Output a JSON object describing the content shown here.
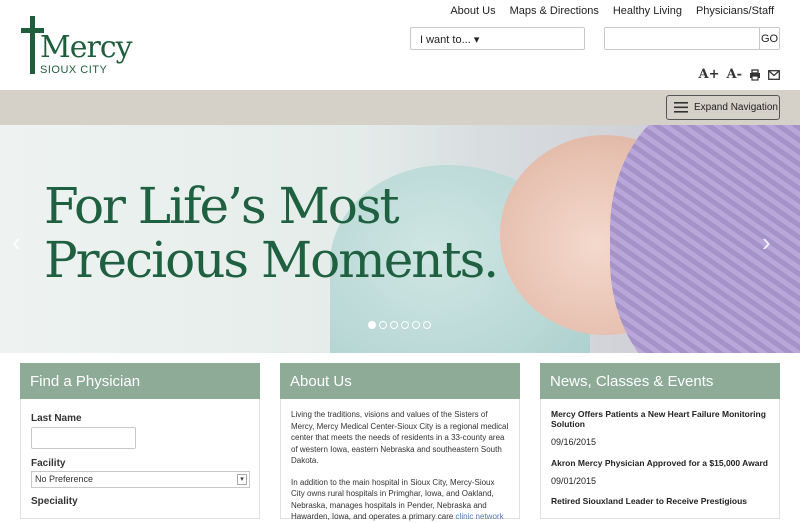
{
  "logo": {
    "word": "Mercy",
    "city": "SIOUX CITY"
  },
  "topnav": [
    "About Us",
    "Maps & Directions",
    "Healthy Living",
    "Physicians/Staff"
  ],
  "iwant": {
    "label": "I want to...",
    "caret": "▾"
  },
  "search": {
    "placeholder": "",
    "go_label": "GO"
  },
  "tools": {
    "font_up": "A+",
    "font_down": "A-",
    "print_icon": "printer-icon",
    "mail_icon": "envelope-icon"
  },
  "navbar": {
    "expand_label": "Expand Navigation"
  },
  "hero": {
    "headline_line1": "For Life’s Most",
    "headline_line2": "Precious Moments.",
    "prev": "‹",
    "next": "›",
    "slides": 6,
    "active_slide": 1
  },
  "find_physician": {
    "title": "Find a Physician",
    "last_name_label": "Last Name",
    "facility_label": "Facility",
    "facility_value": "No Preference",
    "speciality_label": "Speciality"
  },
  "about": {
    "title": "About Us",
    "para1": "Living the traditions, visions and values of the Sisters of Mercy, Mercy Medical Center-Sioux City is a regional medical center that meets the needs of residents in a 33-county area of western Iowa, eastern Nebraska and southeastern South Dakota.",
    "para2": "In addition to the main hospital in Sioux City, Mercy-Sioux City owns rural hospitals in Primghar, Iowa, and Oakland, Nebraska, manages hospitals in Pender, Nebraska and Hawarden, Iowa, and operates a primary care",
    "para2_link": "clinic network"
  },
  "news": {
    "title": "News, Classes & Events",
    "items": [
      {
        "title": "Mercy Offers Patients a New Heart Failure Monitoring Solution",
        "date": "09/16/2015"
      },
      {
        "title": "Akron Mercy Physician Approved for a $15,000 Award",
        "date": "09/01/2015"
      },
      {
        "title": "Retired Siouxland Leader to Receive Prestigious",
        "date": ""
      }
    ]
  },
  "colors": {
    "brand_green": "#1f5e3c",
    "panel_green": "#8dab97",
    "nav_bg": "#d5d0c8"
  }
}
